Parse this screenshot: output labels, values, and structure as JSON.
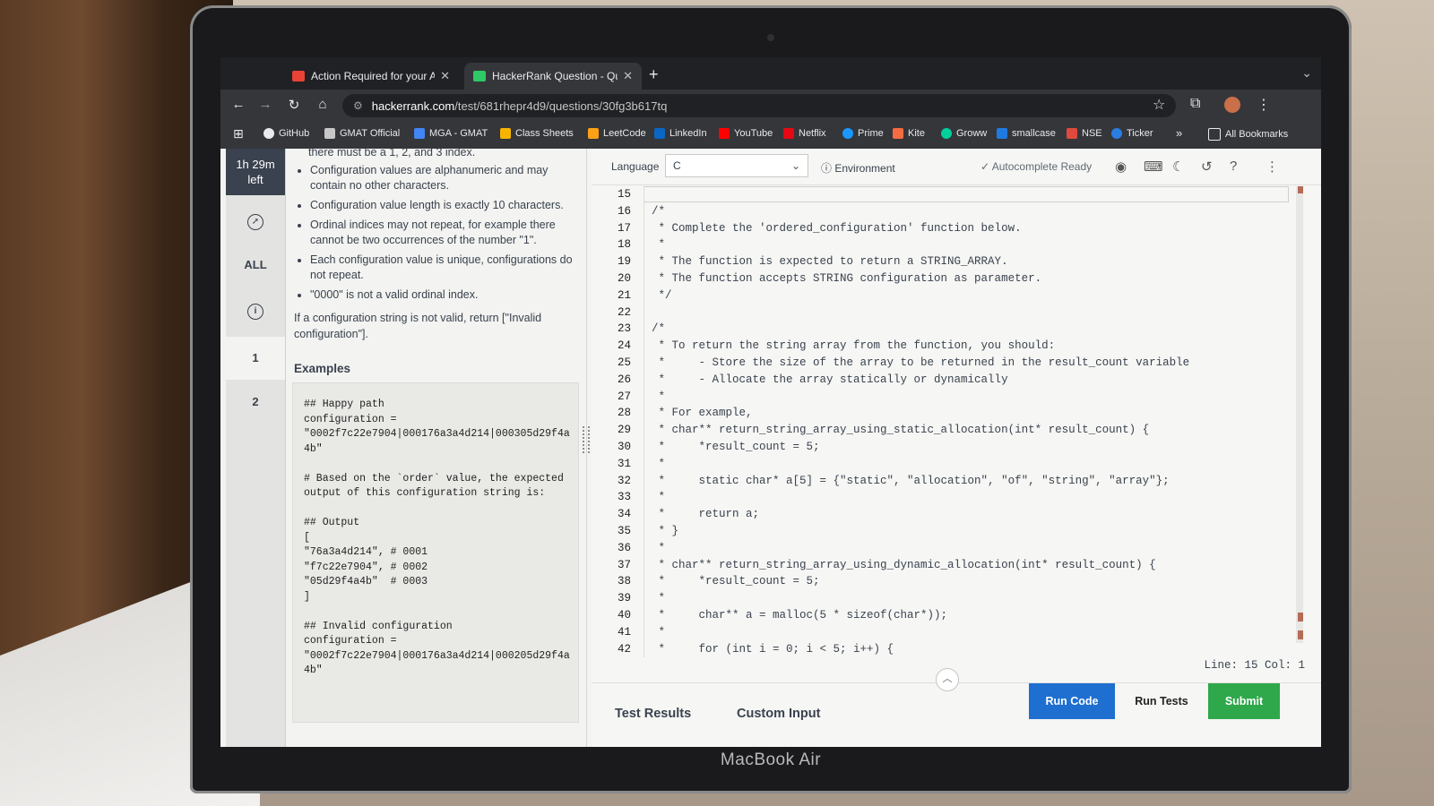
{
  "browser": {
    "tabs": [
      {
        "title": "Action Required for your Am",
        "icon": "gmail-icon",
        "color": "#ea4335"
      },
      {
        "title": "HackerRank Question - Quest",
        "icon": "hackerrank-icon",
        "color": "#2ec866"
      }
    ],
    "url_host": "hackerrank.com",
    "url_path": "/test/681rhepr4d9/questions/30fg3b617tq",
    "bookmarks": [
      {
        "label": "GitHub",
        "color": "#e8eaed"
      },
      {
        "label": "GMAT Official",
        "color": "#c7c7c7"
      },
      {
        "label": "MGA - GMAT",
        "color": "#4285f4"
      },
      {
        "label": "Class Sheets",
        "color": "#f4b400"
      },
      {
        "label": "LeetCode",
        "color": "#ffa116"
      },
      {
        "label": "LinkedIn",
        "color": "#0a66c2"
      },
      {
        "label": "YouTube",
        "color": "#ff0000"
      },
      {
        "label": "Netflix",
        "color": "#e50914"
      },
      {
        "label": "Prime",
        "color": "#1a98ff"
      },
      {
        "label": "Kite",
        "color": "#f56c42"
      },
      {
        "label": "Groww",
        "color": "#00d09c"
      },
      {
        "label": "smallcase",
        "color": "#1f7ae0"
      },
      {
        "label": "NSE",
        "color": "#e04a3c"
      },
      {
        "label": "Ticker",
        "color": "#2a7de1"
      }
    ],
    "more": "»",
    "all_bookmarks": "All Bookmarks"
  },
  "sidebar": {
    "timer_line1": "1h 29m",
    "timer_line2": "left",
    "all_label": "ALL",
    "questions": [
      "1",
      "2"
    ]
  },
  "problem": {
    "partial_line": "there must be a 1, 2, and 3 index.",
    "rules": [
      "Configuration values are alphanumeric and may contain no other characters.",
      "Configuration value length is exactly 10 characters.",
      "Ordinal indices may not repeat, for example there cannot be two occurrences of the number \"1\".",
      "Each configuration value is unique, configurations do not repeat.",
      "\"0000\" is not a valid ordinal index."
    ],
    "invalid_note": "If a configuration string is not valid, return [\"Invalid configuration\"].",
    "examples_heading": "Examples",
    "example_code": "## Happy path\nconfiguration =\n\"0002f7c22e7904|000176a3a4d214|000305d29f4a4b\"\n\n# Based on the `order` value, the expected output of this configuration string is:\n\n## Output\n[\n\"76a3a4d214\", # 0001\n\"f7c22e7904\", # 0002\n\"05d29f4a4b\"  # 0003\n]\n\n## Invalid configuration\nconfiguration =\n\"0002f7c22e7904|000176a3a4d214|000205d29f4a4b\""
  },
  "editor": {
    "language_label": "Language",
    "language_value": "C",
    "environment_label": "Environment",
    "autocomplete_label": "Autocomplete Ready",
    "lines": [
      {
        "n": "15",
        "t": ""
      },
      {
        "n": "16",
        "t": "/*"
      },
      {
        "n": "17",
        "t": " * Complete the 'ordered_configuration' function below."
      },
      {
        "n": "18",
        "t": " *"
      },
      {
        "n": "19",
        "t": " * The function is expected to return a STRING_ARRAY."
      },
      {
        "n": "20",
        "t": " * The function accepts STRING configuration as parameter."
      },
      {
        "n": "21",
        "t": " */"
      },
      {
        "n": "22",
        "t": ""
      },
      {
        "n": "23",
        "t": "/*"
      },
      {
        "n": "24",
        "t": " * To return the string array from the function, you should:"
      },
      {
        "n": "25",
        "t": " *     - Store the size of the array to be returned in the result_count variable"
      },
      {
        "n": "26",
        "t": " *     - Allocate the array statically or dynamically"
      },
      {
        "n": "27",
        "t": " *"
      },
      {
        "n": "28",
        "t": " * For example,"
      },
      {
        "n": "29",
        "t": " * char** return_string_array_using_static_allocation(int* result_count) {"
      },
      {
        "n": "30",
        "t": " *     *result_count = 5;"
      },
      {
        "n": "31",
        "t": " *"
      },
      {
        "n": "32",
        "t": " *     static char* a[5] = {\"static\", \"allocation\", \"of\", \"string\", \"array\"};"
      },
      {
        "n": "33",
        "t": " *"
      },
      {
        "n": "34",
        "t": " *     return a;"
      },
      {
        "n": "35",
        "t": " * }"
      },
      {
        "n": "36",
        "t": " *"
      },
      {
        "n": "37",
        "t": " * char** return_string_array_using_dynamic_allocation(int* result_count) {"
      },
      {
        "n": "38",
        "t": " *     *result_count = 5;"
      },
      {
        "n": "39",
        "t": " *"
      },
      {
        "n": "40",
        "t": " *     char** a = malloc(5 * sizeof(char*));"
      },
      {
        "n": "41",
        "t": " *"
      },
      {
        "n": "42",
        "t": " *     for (int i = 0; i < 5; i++) {"
      }
    ],
    "status": "Line: 15 Col: 1",
    "tabs": [
      "Test Results",
      "Custom Input"
    ],
    "run_code": "Run Code",
    "run_tests": "Run Tests",
    "submit": "Submit"
  },
  "device_label": "MacBook Air"
}
